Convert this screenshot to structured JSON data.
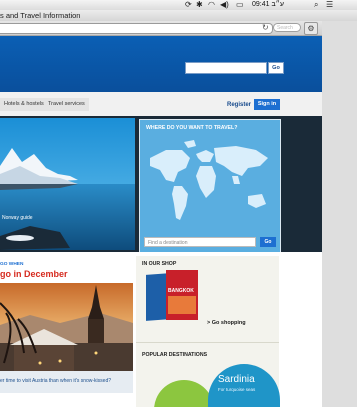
{
  "menubar": {
    "icons": [
      "sync-icon",
      "bluetooth-icon",
      "wifi-icon",
      "volume-icon",
      "keyboard-icon"
    ],
    "clock": "09:41 ע״ב",
    "right_icons": [
      "spotlight-icon",
      "notification-list-icon"
    ]
  },
  "window": {
    "title": "s and Travel Information",
    "search_placeholder": "Search",
    "reload_icon": "reload-icon",
    "gear_icon": "gear-icon"
  },
  "page": {
    "top_search_go": "Go",
    "nav": {
      "tab_hotels": "Hotels & hostels",
      "tab_travel": "Travel services",
      "register": "Register",
      "sign_in": "Sign in"
    },
    "hero": {
      "guide_label": "Norway guide"
    },
    "map": {
      "title": "WHERE DO YOU WANT TO TRAVEL?",
      "input_placeholder": "Find a destination",
      "go": "Go"
    },
    "go_when": {
      "kicker": "GO WHEN",
      "title": "go in December",
      "caption": "er time to visit Austria than when it's snow-kissed?"
    },
    "shop": {
      "title": "IN OUR SHOP",
      "book_label": "BANGKOK",
      "link": "> Go shopping"
    },
    "popular": {
      "title": "POPULAR DESTINATIONS",
      "destination": "Sardinia",
      "subtitle": "For turquoise seas"
    }
  },
  "colors": {
    "brand_blue": "#0b5fb4",
    "accent_red": "#d62b1f",
    "link_blue": "#1d6fd1",
    "map_sea": "#5aaee0"
  }
}
